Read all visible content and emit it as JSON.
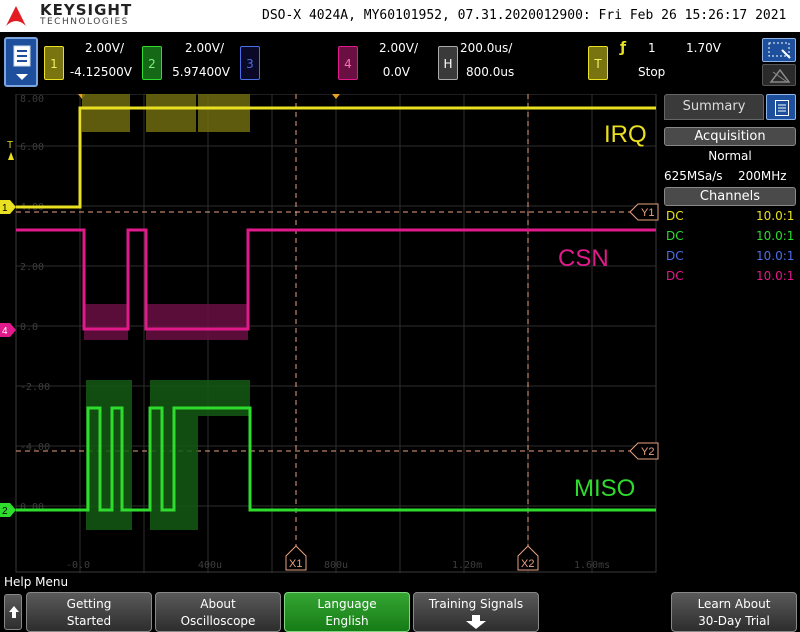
{
  "header": {
    "brand": "KEYSIGHT",
    "brand_sub": "TECHNOLOGIES",
    "title": "DSO-X 4024A, MY60101952, 07.31.2020012900: Fri Feb 26 15:26:17 2021"
  },
  "channels": [
    {
      "num": "1",
      "scale": "2.00V/",
      "offset": "-4.12500V",
      "color": "#e8e020"
    },
    {
      "num": "2",
      "scale": "2.00V/",
      "offset": "5.97400V",
      "color": "#2ddc2d"
    },
    {
      "num": "3",
      "color": "#4a6fe8"
    },
    {
      "num": "4",
      "scale": "2.00V/",
      "offset": "0.0V",
      "color": "#e01a8a"
    }
  ],
  "horizontal": {
    "key": "H",
    "timebase": "200.0us/",
    "delay": "800.0us"
  },
  "trigger": {
    "key": "T",
    "edge_glyph": "ƒ",
    "source": "1",
    "level": "1.70V",
    "state": "Stop"
  },
  "waveform": {
    "signal_labels": [
      {
        "id": "irq",
        "text": "IRQ",
        "color": "#e8e020"
      },
      {
        "id": "csn",
        "text": "CSN",
        "color": "#e01a8a"
      },
      {
        "id": "miso",
        "text": "MISO",
        "color": "#2ddc2d"
      }
    ],
    "cursor_labels": {
      "y1": "Y1",
      "y2": "Y2",
      "x1": "X1",
      "x2": "X2"
    },
    "axis_ghost_labels": [
      "8.00",
      "6.00",
      "4.00",
      "2.00",
      "0.0",
      "-2.00",
      "-4.00",
      "0.00"
    ],
    "time_ghost_labels": [
      "-0.0",
      "400u",
      "800u",
      "1.20m",
      "1.60ms"
    ],
    "channel_markers": {
      "ch1": "1",
      "ch4": "4",
      "ch2": "2",
      "trigger": "T"
    }
  },
  "panel": {
    "tab": "Summary",
    "acquisition_header": "Acquisition",
    "mode": "Normal",
    "rate": "625MSa/s",
    "bandwidth": "200MHz",
    "channels_header": "Channels",
    "rows": [
      {
        "coupling": "DC",
        "probe": "10.0:1",
        "color": "#e8e020"
      },
      {
        "coupling": "DC",
        "probe": "10.0:1",
        "color": "#2ddc2d"
      },
      {
        "coupling": "DC",
        "probe": "10.0:1",
        "color": "#4a6fe8"
      },
      {
        "coupling": "DC",
        "probe": "10.0:1",
        "color": "#e01a8a"
      }
    ]
  },
  "help_menu": "Help Menu",
  "softkeys": [
    {
      "line1": "Getting",
      "line2": "Started"
    },
    {
      "line1": "About",
      "line2": "Oscilloscope"
    },
    {
      "line1": "Language",
      "line2": "English"
    },
    {
      "line1": "Training Signals",
      "line2": ""
    },
    {
      "line1": "Learn About",
      "line2": "30-Day Trial"
    }
  ]
}
